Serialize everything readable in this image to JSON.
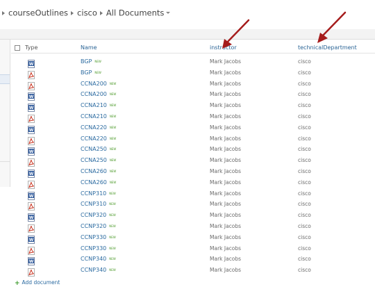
{
  "breadcrumb": {
    "site": "courseOutlines",
    "library": "cisco",
    "view": "All Documents"
  },
  "columns": {
    "type": "Type",
    "name": "Name",
    "instructor": "instructor",
    "technicalDepartment": "technicalDepartment"
  },
  "new_badge": "NEW",
  "rows": [
    {
      "name": "BGP",
      "icon": "word-icon",
      "instructor": "Mark Jacobs",
      "dept": "cisco"
    },
    {
      "name": "BGP",
      "icon": "pdf-icon",
      "instructor": "Mark Jacobs",
      "dept": "cisco"
    },
    {
      "name": "CCNA200",
      "icon": "pdf-icon",
      "instructor": "Mark Jacobs",
      "dept": "cisco"
    },
    {
      "name": "CCNA200",
      "icon": "word-icon",
      "instructor": "Mark Jacobs",
      "dept": "cisco"
    },
    {
      "name": "CCNA210",
      "icon": "word-icon",
      "instructor": "Mark Jacobs",
      "dept": "cisco"
    },
    {
      "name": "CCNA210",
      "icon": "pdf-icon",
      "instructor": "Mark Jacobs",
      "dept": "cisco"
    },
    {
      "name": "CCNA220",
      "icon": "word-icon",
      "instructor": "Mark Jacobs",
      "dept": "cisco"
    },
    {
      "name": "CCNA220",
      "icon": "pdf-icon",
      "instructor": "Mark Jacobs",
      "dept": "cisco"
    },
    {
      "name": "CCNA250",
      "icon": "word-icon",
      "instructor": "Mark Jacobs",
      "dept": "cisco"
    },
    {
      "name": "CCNA250",
      "icon": "pdf-icon",
      "instructor": "Mark Jacobs",
      "dept": "cisco"
    },
    {
      "name": "CCNA260",
      "icon": "word-icon",
      "instructor": "Mark Jacobs",
      "dept": "cisco"
    },
    {
      "name": "CCNA260",
      "icon": "pdf-icon",
      "instructor": "Mark Jacobs",
      "dept": "cisco"
    },
    {
      "name": "CCNP310",
      "icon": "word-icon",
      "instructor": "Mark Jacobs",
      "dept": "cisco"
    },
    {
      "name": "CCNP310",
      "icon": "pdf-icon",
      "instructor": "Mark Jacobs",
      "dept": "cisco"
    },
    {
      "name": "CCNP320",
      "icon": "word-icon",
      "instructor": "Mark Jacobs",
      "dept": "cisco"
    },
    {
      "name": "CCNP320",
      "icon": "pdf-icon",
      "instructor": "Mark Jacobs",
      "dept": "cisco"
    },
    {
      "name": "CCNP330",
      "icon": "word-icon",
      "instructor": "Mark Jacobs",
      "dept": "cisco"
    },
    {
      "name": "CCNP330",
      "icon": "pdf-icon",
      "instructor": "Mark Jacobs",
      "dept": "cisco"
    },
    {
      "name": "CCNP340",
      "icon": "word-icon",
      "instructor": "Mark Jacobs",
      "dept": "cisco"
    },
    {
      "name": "CCNP340",
      "icon": "pdf-icon",
      "instructor": "Mark Jacobs",
      "dept": "cisco"
    }
  ],
  "add_document": "Add document",
  "colors": {
    "link": "#2a6aa0",
    "new_badge": "#4c9a2a",
    "arrow": "#a51c1c",
    "word": "#2b579a",
    "pdf": "#c8321f"
  }
}
